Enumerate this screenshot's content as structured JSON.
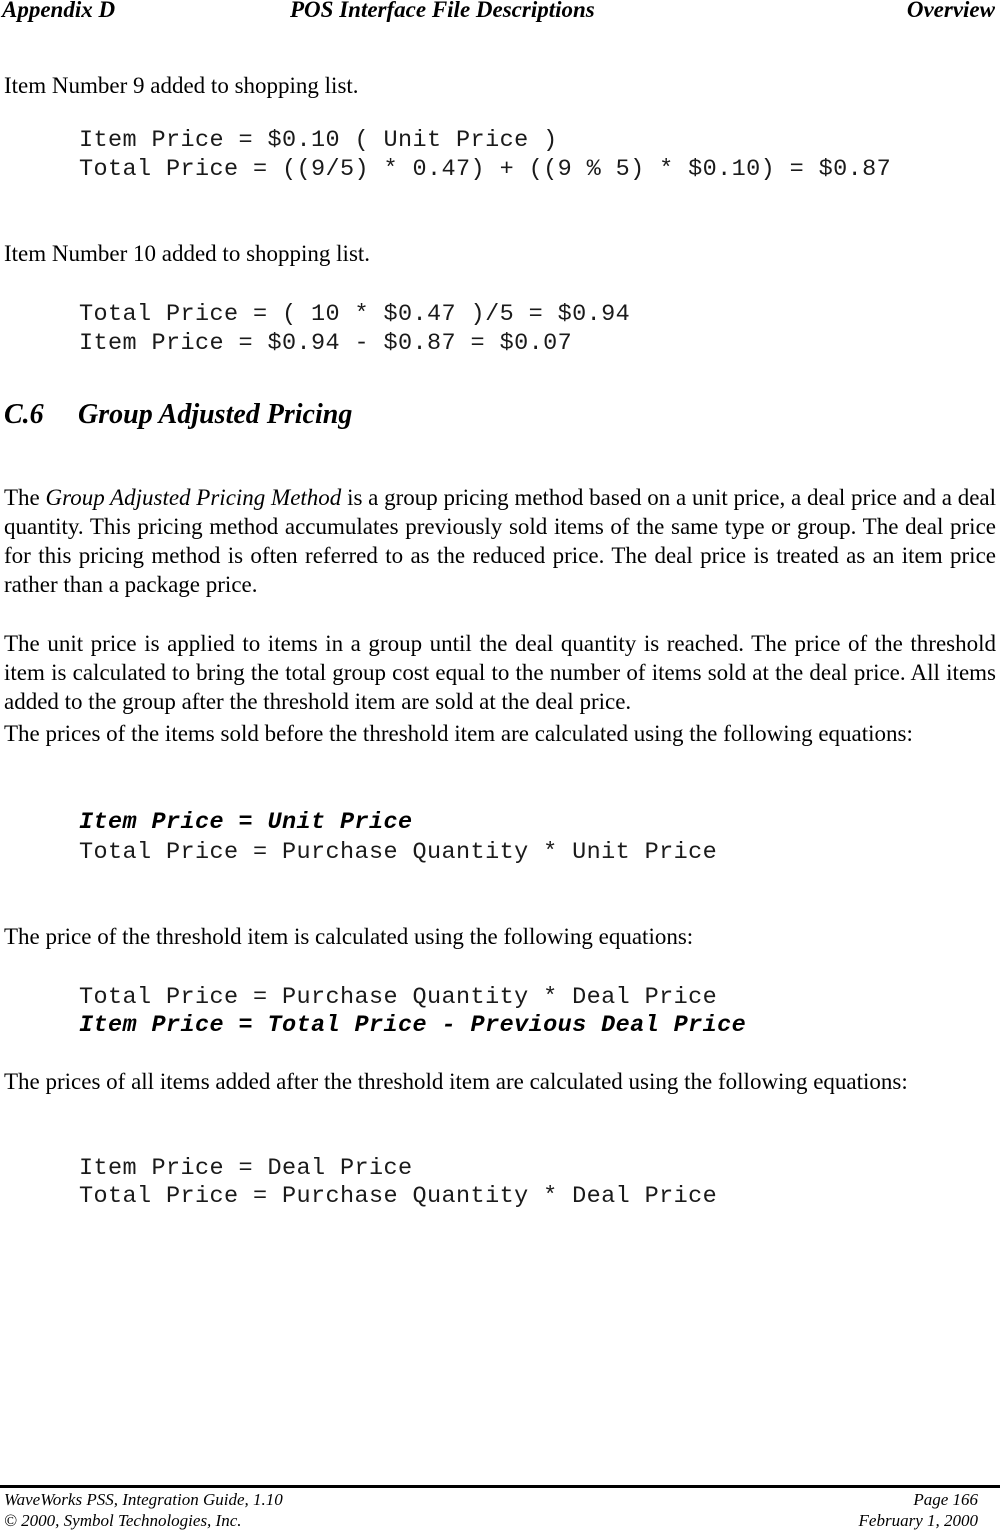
{
  "header": {
    "left": "Appendix D",
    "center": "POS Interface File Descriptions",
    "right": "Overview"
  },
  "example_9": {
    "caption": "Item Number 9 added to shopping list.",
    "lines": [
      "Item Price  = $0.10 ( Unit Price )",
      "Total Price = ((9/5) * 0.47) + ((9 % 5) * $0.10) = $0.87"
    ]
  },
  "example_10": {
    "caption": "Item Number 10 added to shopping list.",
    "lines": [
      "Total Price = ( 10 * $0.47 )/5 = $0.94",
      "Item Price  = $0.94 - $0.87 = $0.07"
    ]
  },
  "section": {
    "number": "C.6",
    "title": "Group Adjusted Pricing"
  },
  "paragraphs": {
    "p1_prefix": "The ",
    "p1_term": "Group Adjusted Pricing Method",
    "p1_rest": " is a group pricing method based on a unit price, a deal price and a deal quantity.  This pricing method accumulates previously sold items of the same type or group.  The deal price for this pricing method is often referred to as the reduced price.  The deal price is treated as an item price rather than a package price.",
    "p2": "The unit price is applied to items in a group until the deal quantity is reached.  The price of the threshold item is calculated to bring the total group cost equal to the number of items sold at the deal price.  All items added to the group after the threshold item are sold at the deal price.",
    "p3": "The prices of the items sold before the threshold item are calculated using the following equations:",
    "p4": "The price of the threshold item is calculated using the following equations:",
    "p5": "The prices of all items added after the threshold item are calculated using the following equations:"
  },
  "equations_before": [
    "Item Price  = Unit Price",
    "Total Price = Purchase Quantity * Unit Price"
  ],
  "equations_threshold": [
    "Total Price = Purchase Quantity * Deal Price",
    "Item Price  = Total Price - Previous Deal Price"
  ],
  "equations_after": [
    "Item Price  = Deal Price",
    "Total Price = Purchase Quantity * Deal Price"
  ],
  "footer": {
    "left_line1": "WaveWorks PSS, Integration Guide, 1.10",
    "left_line2": "© 2000, Symbol Technologies, Inc.",
    "right_line1": "Page 166",
    "right_line2": "February 1, 2000"
  }
}
